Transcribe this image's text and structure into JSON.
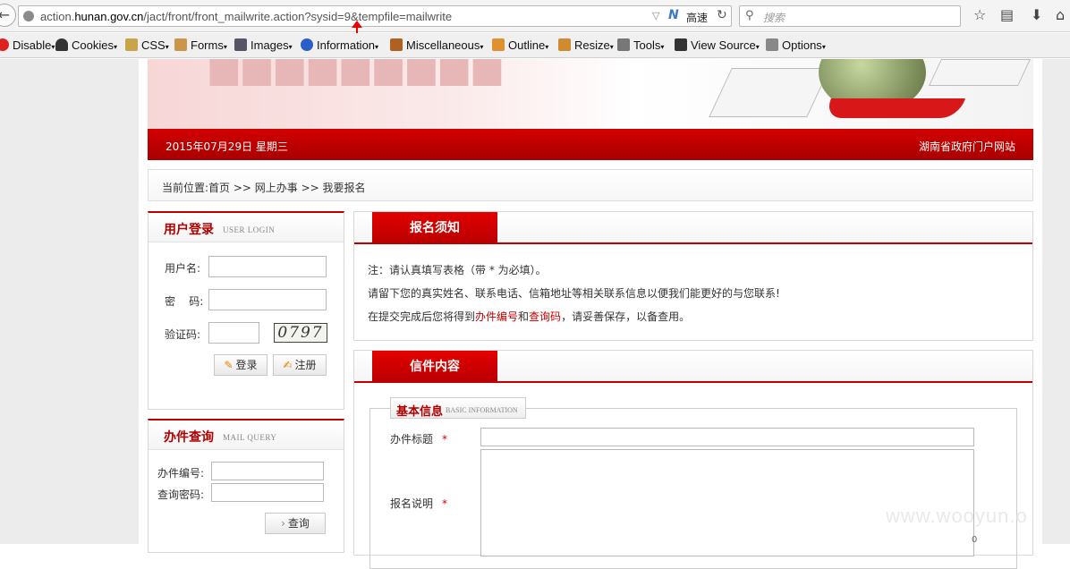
{
  "browser": {
    "url_prefix": "action.",
    "url_domain": "hunan.gov.cn",
    "url_path": "/jact/front/front_mailwrite.action?sysid=9&tempfile=mailwrite",
    "speed_label": "高速",
    "search_placeholder": "搜索"
  },
  "devbar": {
    "items": [
      "Disable",
      "Cookies",
      "CSS",
      "Forms",
      "Images",
      "Information",
      "Miscellaneous",
      "Outline",
      "Resize",
      "Tools",
      "View Source",
      "Options"
    ]
  },
  "header": {
    "date": "2015年07月29日  星期三",
    "portal": "湖南省政府门户网站"
  },
  "breadcrumb": "当前位置:首页 >> 网上办事 >> 我要报名",
  "login": {
    "title": "用户登录",
    "subtitle": "USER LOGIN",
    "username_label": "用户名:",
    "password_label": "密    码:",
    "captcha_label": "验证码:",
    "captcha_value": "0797",
    "login_button": "登录",
    "register_button": "注册"
  },
  "query": {
    "title": "办件查询",
    "subtitle": "MAIL QUERY",
    "number_label": "办件编号:",
    "code_label": "查询密码:",
    "query_button": "查询"
  },
  "notice": {
    "tab": "报名须知",
    "line1": "注：请认真填写表格（带 * 为必填）。",
    "line2": "请留下您的真实姓名、联系电话、信箱地址等相关联系信息以便我们能更好的与您联系!",
    "line3_a": "在提交完成后您将得到",
    "line3_b": "办件编号",
    "line3_c": "和",
    "line3_d": "查询码",
    "line3_e": "，请妥善保存，以备查用。"
  },
  "letter": {
    "tab": "信件内容",
    "section_title": "基本信息",
    "section_subtitle": "BASIC INFORMATION",
    "title_label": "办件标题",
    "desc_label": "报名说明",
    "required_mark": "*",
    "counter": "0"
  },
  "watermark": "www.wooyun.o"
}
